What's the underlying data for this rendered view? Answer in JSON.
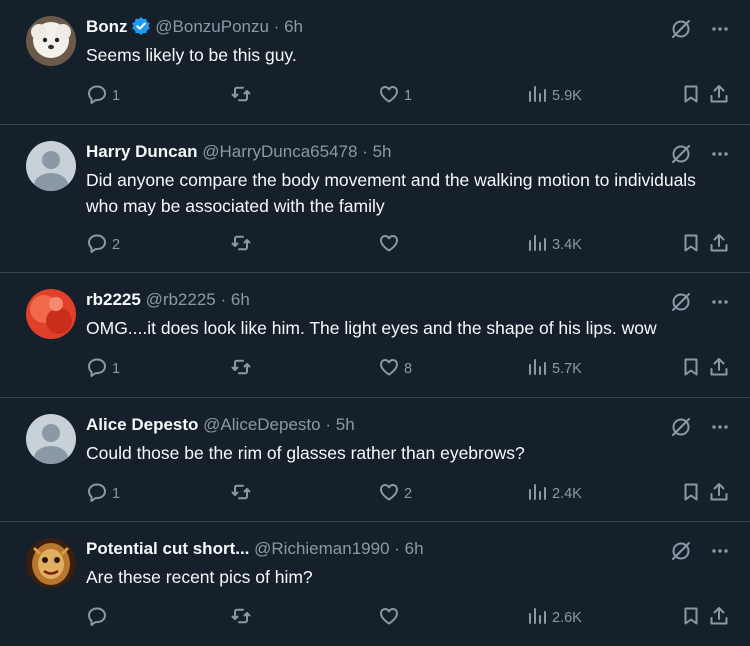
{
  "colors": {
    "background": "#15202b",
    "divider": "#38444d",
    "muted": "#8b98a5",
    "text": "#f7f9f9",
    "verified": "#1d9bf0"
  },
  "tweets": [
    {
      "name": "Bonz",
      "handle": "@BonzuPonzu",
      "sep": "·",
      "time": "6h",
      "verified": true,
      "avatar": "dog-photo",
      "text": "Seems likely to be this guy.",
      "replies": "1",
      "retweets": "",
      "likes": "1",
      "views": "5.9K"
    },
    {
      "name": "Harry Duncan",
      "handle": "@HarryDunca65478",
      "sep": "·",
      "time": "5h",
      "verified": false,
      "avatar": "default-avatar",
      "text": "Did anyone compare the body movement and the walking motion to individuals who may be associated with the family",
      "replies": "2",
      "retweets": "",
      "likes": "",
      "views": "3.4K"
    },
    {
      "name": "rb2225",
      "handle": "@rb2225",
      "sep": "·",
      "time": "6h",
      "verified": false,
      "avatar": "red-abstract",
      "text": "OMG....it does look like him. The light eyes and the shape of his lips. wow",
      "replies": "1",
      "retweets": "",
      "likes": "8",
      "views": "5.7K"
    },
    {
      "name": "Alice Depesto",
      "handle": "@AliceDepesto",
      "sep": "·",
      "time": "5h",
      "verified": false,
      "avatar": "default-avatar",
      "text": "Could those be the rim of glasses rather than eyebrows?",
      "replies": "1",
      "retweets": "",
      "likes": "2",
      "views": "2.4K"
    },
    {
      "name": "Potential cut short...",
      "handle": "@Richieman1990",
      "sep": "·",
      "time": "6h",
      "verified": false,
      "avatar": "mask-artwork",
      "text": "Are these recent pics of him?",
      "replies": "",
      "retweets": "",
      "likes": "",
      "views": "2.6K"
    }
  ]
}
